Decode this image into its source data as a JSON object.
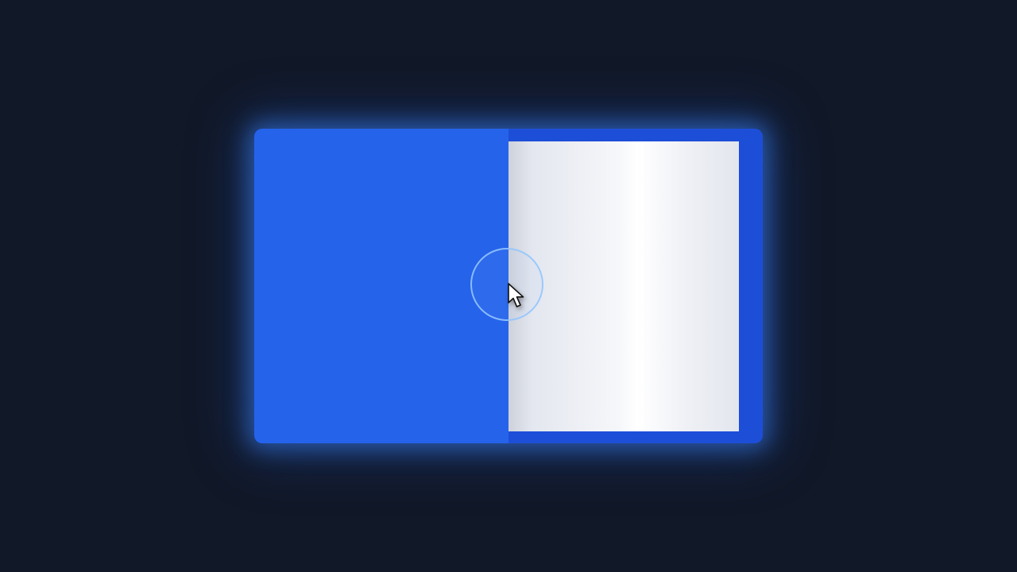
{
  "scene": {
    "background_color": "#111827",
    "folder": {
      "cover_color": "#2563eb",
      "back_color": "#1d4ed8",
      "page_color": "#f3f4f8",
      "glow_color": "#3b82f6"
    },
    "cursor": {
      "icon": "mouse-pointer-icon",
      "click_ring_color": "#93c5fd"
    }
  }
}
